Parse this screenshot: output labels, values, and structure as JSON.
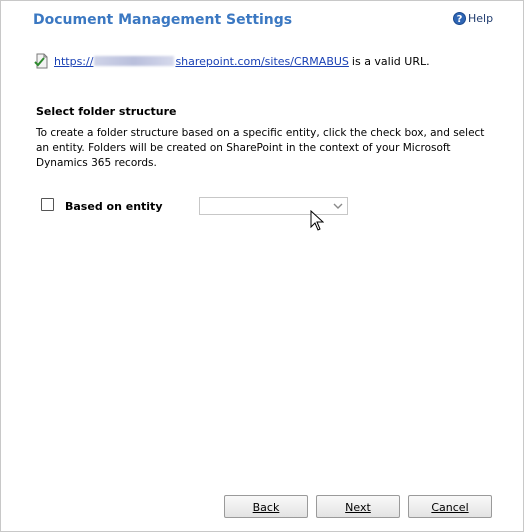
{
  "dialog": {
    "title": "Document Management Settings",
    "help_label": "Help",
    "help_icon_glyph": "?"
  },
  "url_status": {
    "icon": "document-check-icon",
    "link_prefix": "https://",
    "link_suffix": "sharepoint.com/sites/CRMABUS",
    "status_text": "is a valid URL."
  },
  "folder_structure": {
    "heading": "Select folder structure",
    "description": "To create a folder structure based on a specific entity, click the check box, and select an entity. Folders will be created on SharePoint in the context of your Microsoft Dynamics 365 records.",
    "checkbox_label": "Based on entity",
    "checkbox_checked": false,
    "entity_select_value": ""
  },
  "buttons": {
    "back": "Back",
    "next": "Next",
    "cancel": "Cancel"
  },
  "colors": {
    "title": "#3b78c2",
    "link": "#1a41b5"
  }
}
